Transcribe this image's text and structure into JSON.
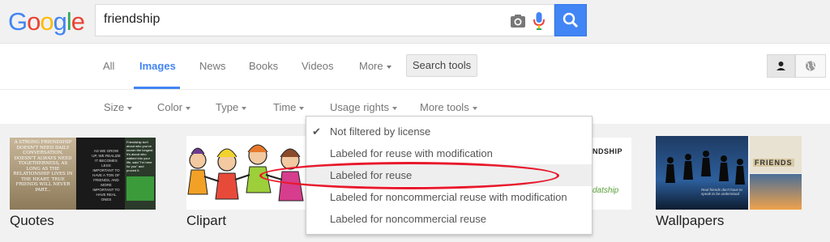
{
  "logo": {
    "letters": [
      "G",
      "o",
      "o",
      "g",
      "l",
      "e"
    ],
    "colors": [
      "#4285f4",
      "#ea4335",
      "#fbbc05",
      "#4285f4",
      "#34a853",
      "#ea4335"
    ]
  },
  "search": {
    "query": "friendship"
  },
  "tabs": [
    {
      "label": "All"
    },
    {
      "label": "Images"
    },
    {
      "label": "News"
    },
    {
      "label": "Books"
    },
    {
      "label": "Videos"
    },
    {
      "label": "More"
    }
  ],
  "search_tools_label": "Search tools",
  "tools": [
    {
      "label": "Size"
    },
    {
      "label": "Color"
    },
    {
      "label": "Type"
    },
    {
      "label": "Time"
    },
    {
      "label": "Usage rights"
    },
    {
      "label": "More tools"
    }
  ],
  "usage_menu": {
    "items": [
      {
        "label": "Not filtered by license",
        "checked": true
      },
      {
        "label": "Labeled for reuse with modification",
        "checked": false
      },
      {
        "label": "Labeled for reuse",
        "checked": false
      },
      {
        "label": "Labeled for noncommercial reuse with modification",
        "checked": false
      },
      {
        "label": "Labeled for noncommercial reuse",
        "checked": false
      }
    ],
    "highlighted_index": 2,
    "check_glyph": "✔"
  },
  "categories": [
    {
      "label": "Quotes"
    },
    {
      "label": "Clipart"
    },
    {
      "label": "Wallpapers"
    }
  ],
  "image_text": {
    "quote_main": "A STRONG FRIENDSHIP DOESN'T NEED DAILY CONVERSATION, DOESN'T ALWAYS NEED TOGETHERNESS, AS LONG AS THE RELATIONSHIP LIVES IN THE HEART, TRUE FRIENDS WILL NEVER PART...",
    "quote_dark": "AS WE GROW UP, WE REALIZE IT BECOMES LESS IMPORTANT TO HAVE A TON OF FRIENDS, AND MORE IMPORTANT TO HAVE REAL ONES",
    "quote_green": "Friendship isn't about who you've known the longest. It's about who walked into your life, said \"I'm here for you\" and proved it.",
    "tiles_word": "FRIENDS",
    "friendship_partial_1": "NDSHIP",
    "friendship_partial_2": "datship",
    "wallpaper_caption": "Real friends don't have to speak to be understood"
  },
  "annotation_color": "#e8192c"
}
